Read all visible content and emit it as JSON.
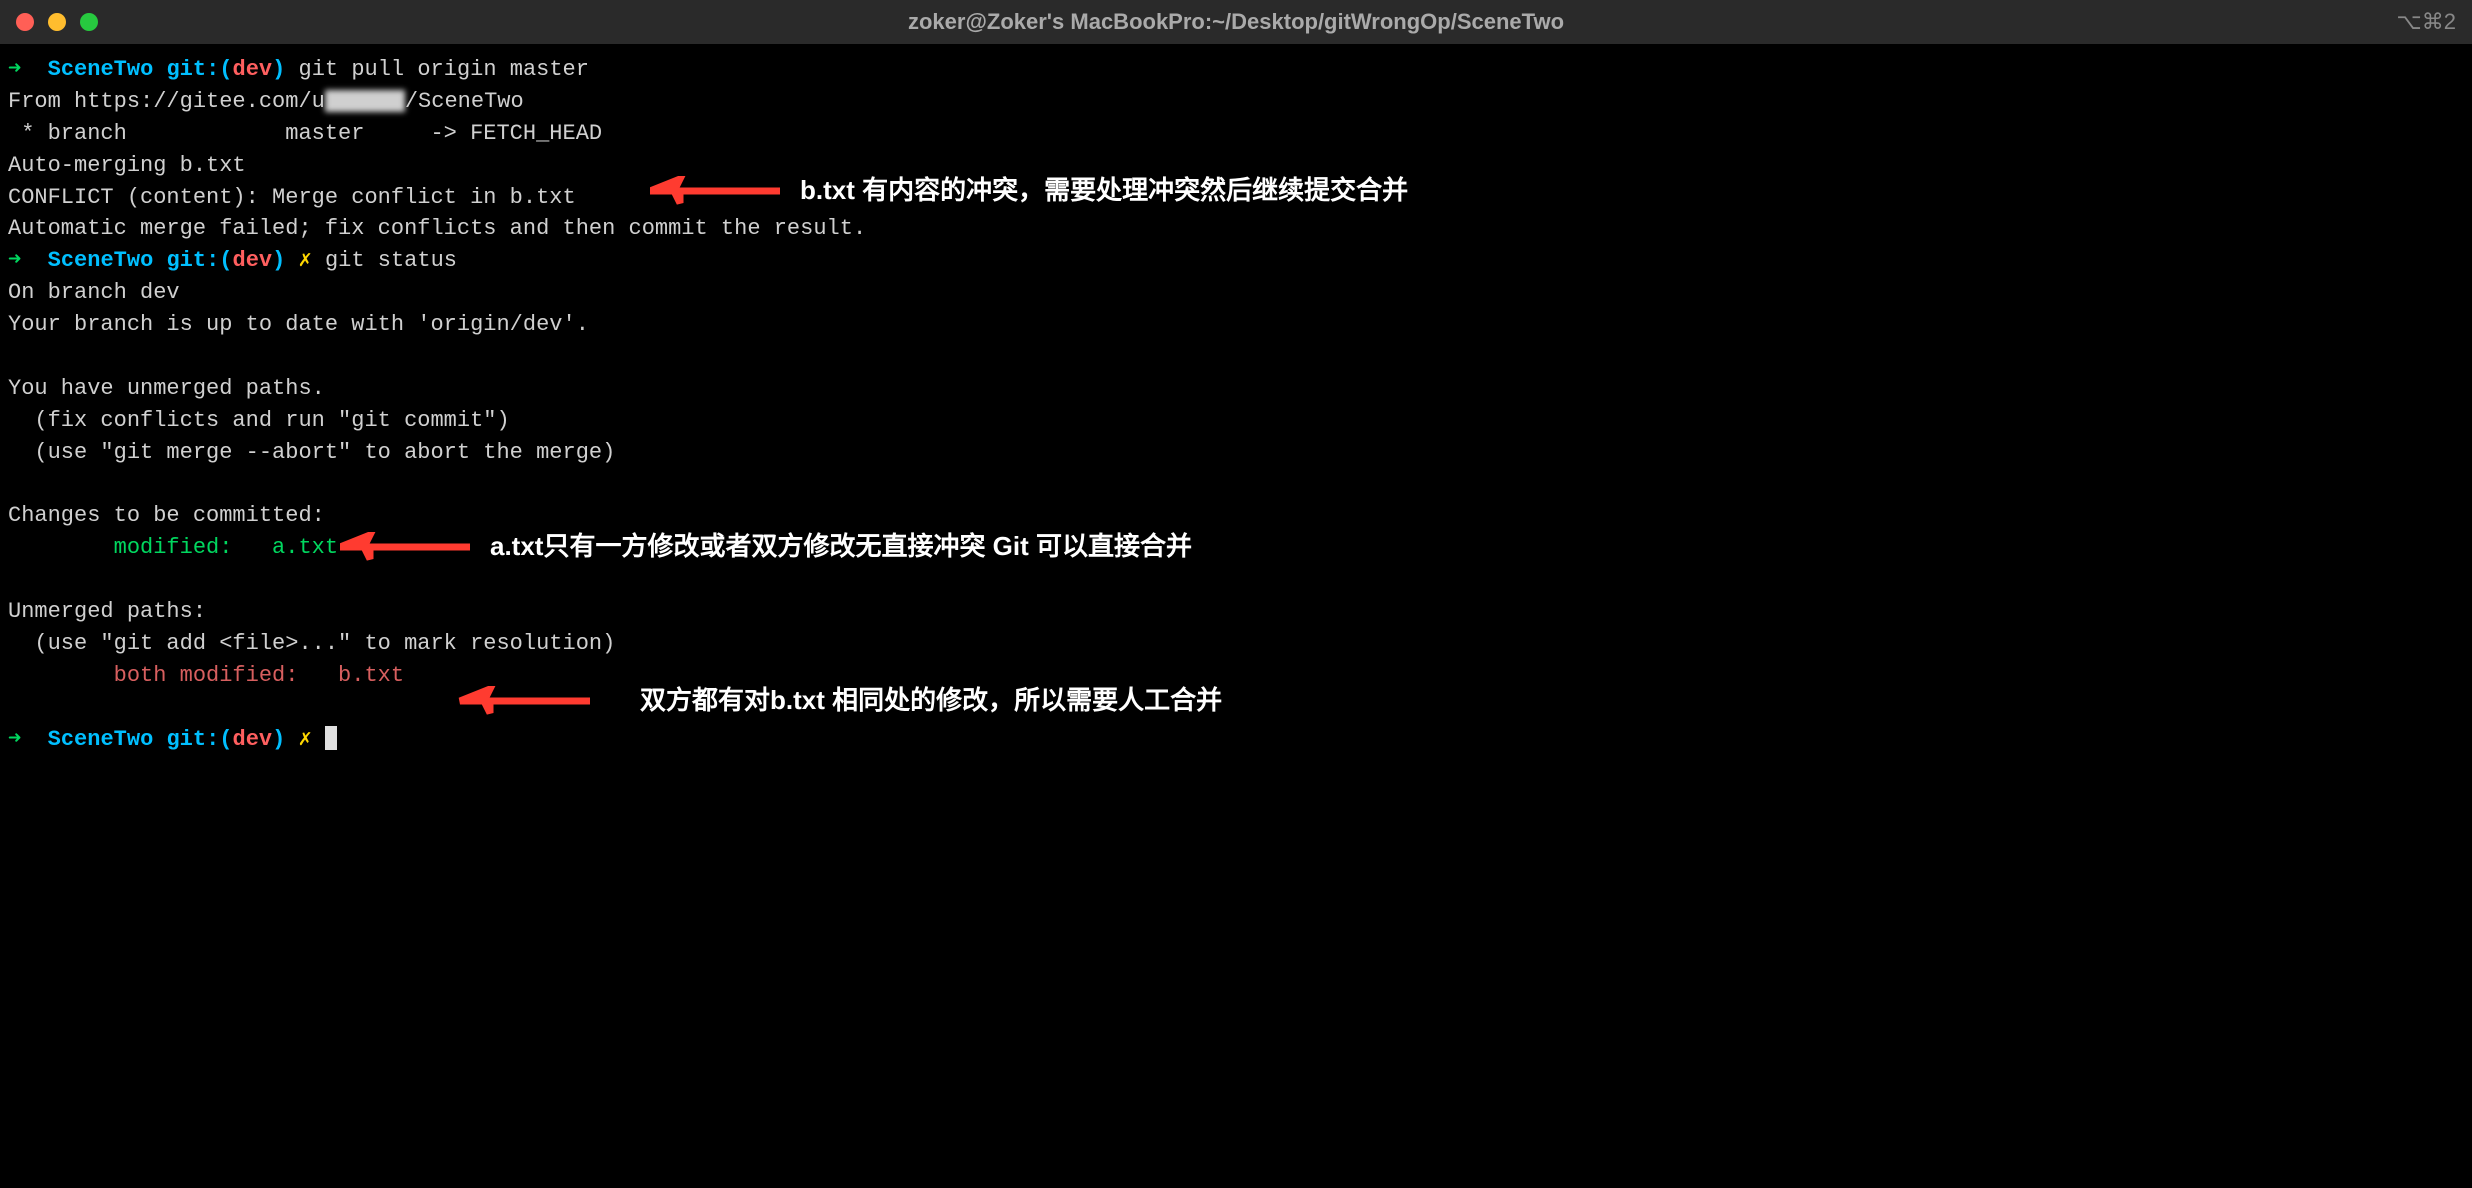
{
  "window": {
    "title": "zoker@Zoker's MacBookPro:~/Desktop/gitWrongOp/SceneTwo",
    "shortcut": "⌥⌘2"
  },
  "prompt": {
    "arrow": "➜",
    "folder": "SceneTwo",
    "git_label": "git:(",
    "git_close": ")",
    "branch": "dev",
    "dirty_mark": "✗"
  },
  "commands": {
    "cmd1": "git pull origin master",
    "cmd2": "git status"
  },
  "output": {
    "from_line": "From https://gitee.com/u",
    "from_suffix": "/SceneTwo",
    "branch_line": " * branch            master     -> FETCH_HEAD",
    "automerge": "Auto-merging b.txt",
    "conflict": "CONFLICT (content): Merge conflict in b.txt",
    "merge_failed": "Automatic merge failed; fix conflicts and then commit the result.",
    "on_branch": "On branch dev",
    "up_to_date": "Your branch is up to date with 'origin/dev'.",
    "unmerged_paths": "You have unmerged paths.",
    "fix_conflicts": "  (fix conflicts and run \"git commit\")",
    "abort_merge": "  (use \"git merge --abort\" to abort the merge)",
    "changes_committed": "Changes to be committed:",
    "modified_a": "        modified:   a.txt",
    "unmerged_header": "Unmerged paths:",
    "use_git_add": "  (use \"git add <file>...\" to mark resolution)",
    "both_modified": "        both modified:   b.txt"
  },
  "annotations": {
    "a1": "b.txt 有内容的冲突，需要处理冲突然后继续提交合并",
    "a2": "a.txt只有一方修改或者双方修改无直接冲突 Git 可以直接合并",
    "a3": "双方都有对b.txt 相同处的修改，所以需要人工合并"
  },
  "colors": {
    "arrow_red": "#ff3b30"
  }
}
